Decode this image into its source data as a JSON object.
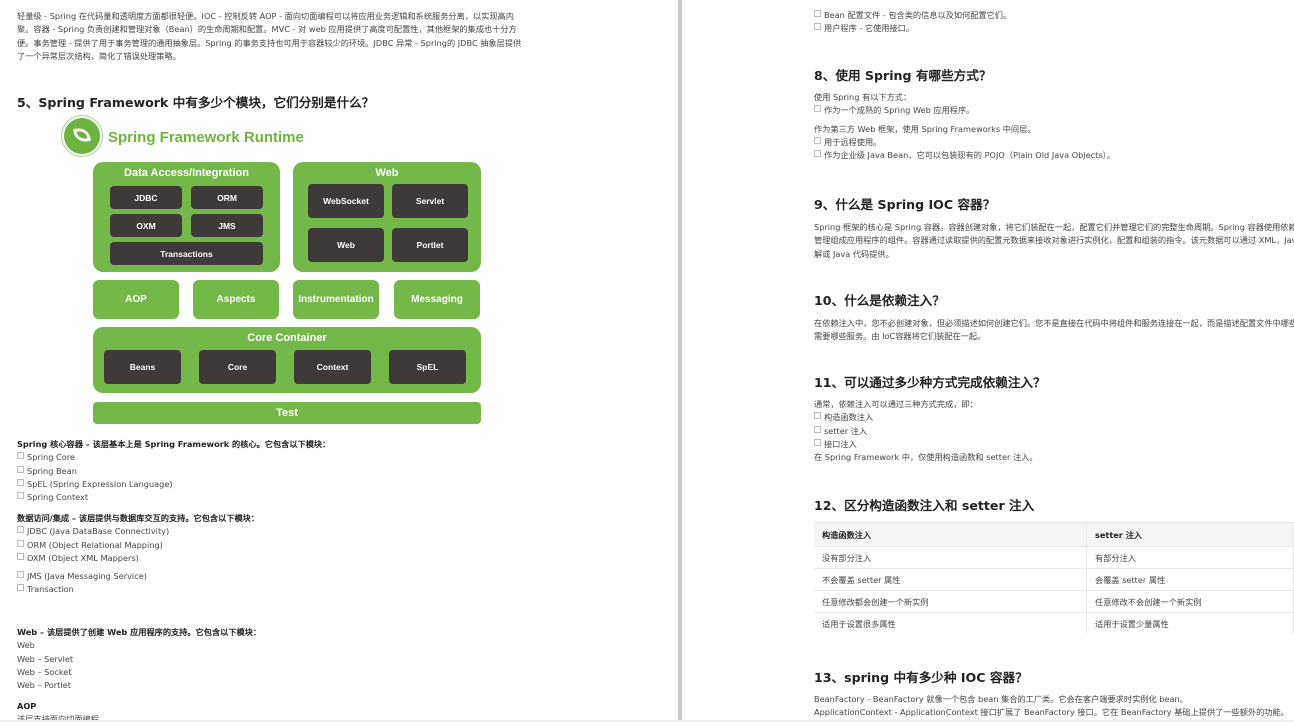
{
  "left": {
    "intro": "轻量级 - Spring 在代码量和透明度方面都很轻便。IOC - 控制反转 AOP - 面向切面编程可以将应用业务逻辑和系统服务分离，以实现高内聚。容器 - Spring 负责创建和管理对象（Bean）的生命周期和配置。MVC - 对 web 应用提供了高度可配置性，其他框架的集成也十分方便。事务管理 - 提供了用于事务管理的通用抽象层。Spring 的事务支持也可用于容器较少的环境。JDBC 异常 - Spring的 JDBC 抽象层提供了一个异常层次结构，简化了错误处理策略。",
    "intro_lines": [
      "轻量级 - Spring 在代码量和透明度方面都很轻便。IOC - 控制反转 AOP - 面向切面编程可以将应用业务逻辑和系统服务分离，以实现高内",
      "聚。容器 - Spring 负责创建和管理对象（Bean）的生命周期和配置。MVC - 对 web 应用提供了高度可配置性，其他框架的集成也十分方",
      "便。事务管理 - 提供了用于事务管理的通用抽象层。Spring 的事务支持也可用于容器较少的环境。JDBC 异常 - Spring的 JDBC 抽象层提供",
      "了一个异常层次结构，简化了错误处理策略。"
    ],
    "q5_heading": "5、Spring Framework 中有多少个模块，它们分别是什么？",
    "diagram": {
      "title": "Spring Framework Runtime",
      "data_access": {
        "title": "Data Access/Integration",
        "items": [
          "JDBC",
          "ORM",
          "OXM",
          "JMS",
          "Transactions"
        ]
      },
      "web": {
        "title": "Web",
        "items": [
          "WebSocket",
          "Servlet",
          "Web",
          "Portlet"
        ]
      },
      "middle": [
        "AOP",
        "Aspects",
        "Instrumentation",
        "Messaging"
      ],
      "core": {
        "title": "Core Container",
        "items": [
          "Beans",
          "Core",
          "Context",
          "SpEL"
        ]
      },
      "test": "Test",
      "colors": {
        "green": "#75b84a",
        "dark": "#3d3a39",
        "logo": "#6db33f"
      }
    },
    "core_section": {
      "title": "Spring 核心容器 – 该层基本上是 Spring Framework 的核心。它包含以下模块：",
      "items": [
        "Spring Core",
        "Spring Bean",
        "SpEL (Spring Expression Language)",
        "Spring Context"
      ]
    },
    "data_section": {
      "title": "数据访问/集成 – 该层提供与数据库交互的支持。它包含以下模块：",
      "items": [
        "JDBC (Java DataBase Connectivity)",
        "ORM (Object Relational Mapping)",
        "OXM (Object XML Mappers)"
      ],
      "items2": [
        "JMS (Java Messaging Service)",
        "Transaction"
      ]
    },
    "web_section": {
      "title": "Web – 该层提供了创建 Web 应用程序的支持。它包含以下模块：",
      "items": [
        "Web",
        "Web – Servlet",
        "Web – Socket",
        "Web – Portlet"
      ]
    },
    "aop_section": {
      "title": "AOP",
      "text": "该层支持面向切面编程"
    }
  },
  "right": {
    "top_items": [
      "Bean 配置文件 - 包含类的信息以及如何配置它们。",
      "用户程序 - 它使用接口。"
    ],
    "q8": {
      "heading": "8、使用 Spring 有哪些方式？",
      "intro": "使用 Spring 有以下方式：",
      "item1": "作为一个成熟的 Spring Web 应用程序。",
      "line2": "作为第三方 Web 框架，使用 Spring Frameworks 中间层。",
      "items": [
        "用于远程使用。",
        "作为企业级 Java Bean，它可以包装现有的 POJO（Plain Old Java Objects）。"
      ]
    },
    "q9": {
      "heading": "9、什么是 Spring IOC 容器？",
      "lines": [
        "Spring 框架的核心是 Spring 容器。容器创建对象，将它们装配在一起，配置它们并管理它们的完整生命周期。Spring 容器使用依赖注入来",
        "管理组成应用程序的组件。容器通过读取提供的配置元数据来接收对象进行实例化，配置和组装的指令。该元数据可以通过 XML，Java 注",
        "解或 Java 代码提供。"
      ]
    },
    "q10": {
      "heading": "10、什么是依赖注入？",
      "lines": [
        "在依赖注入中，您不必创建对象，但必须描述如何创建它们。您不是直接在代码中将组件和服务连接在一起，而是描述配置文件中哪些组件",
        "需要哪些服务。由 IoC容器将它们装配在一起。"
      ]
    },
    "q11": {
      "heading": "11、可以通过多少种方式完成依赖注入？",
      "intro": "通常，依赖注入可以通过三种方式完成，即：",
      "items": [
        "构造函数注入",
        "setter 注入",
        "接口注入"
      ],
      "outro": "在 Spring Framework 中，仅使用构造函数和 setter 注入。"
    },
    "q12": {
      "heading": "12、区分构造函数注入和 setter 注入",
      "table": {
        "headers": [
          "构造函数注入",
          "setter 注入"
        ],
        "rows": [
          [
            "没有部分注入",
            "有部分注入"
          ],
          [
            "不会覆盖 setter 属性",
            "会覆盖 setter 属性"
          ],
          [
            "任意修改都会创建一个新实例",
            "任意修改不会创建一个新实例"
          ],
          [
            "适用于设置很多属性",
            "适用于设置少量属性"
          ]
        ]
      }
    },
    "q13": {
      "heading": "13、spring 中有多少种 IOC 容器？",
      "lines": [
        "BeanFactory - BeanFactory 就像一个包含 bean 集合的工厂类。它会在客户端要求时实例化 bean。",
        "ApplicationContext - ApplicationContext 接口扩展了 BeanFactory 接口。它在 BeanFactory 基础上提供了一些额外的功能。"
      ]
    }
  }
}
